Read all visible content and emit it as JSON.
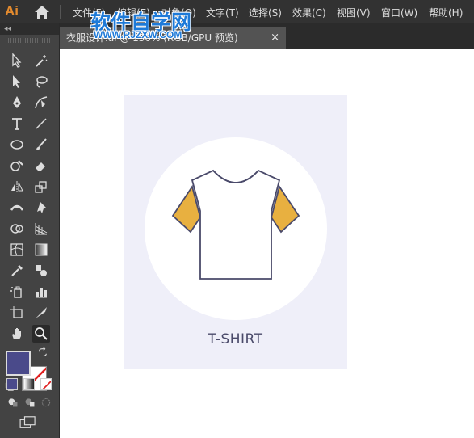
{
  "app": {
    "logo": "Ai"
  },
  "menu": {
    "items": [
      {
        "label": "文件(F)"
      },
      {
        "label": "编辑(E)"
      },
      {
        "label": "对象(O)"
      },
      {
        "label": "文字(T)"
      },
      {
        "label": "选择(S)"
      },
      {
        "label": "效果(C)"
      },
      {
        "label": "视图(V)"
      },
      {
        "label": "窗口(W)"
      },
      {
        "label": "帮助(H)"
      }
    ]
  },
  "watermark": {
    "title": "软件自学网",
    "url": "WWW.RJZXW.COM"
  },
  "document": {
    "tab_label": "衣服设计.ai @ 150% (RGB/GPU 预览)",
    "close_glyph": "×"
  },
  "toolbar": {
    "collapse_glyph": "◂◂"
  },
  "artwork": {
    "caption": "T-SHIRT"
  },
  "colors": {
    "fill": "#4a4a8a",
    "sleeve": "#e8b040",
    "outline": "#4a4a6a",
    "artboard_bg": "#efeff9",
    "collar": "#dedede"
  }
}
